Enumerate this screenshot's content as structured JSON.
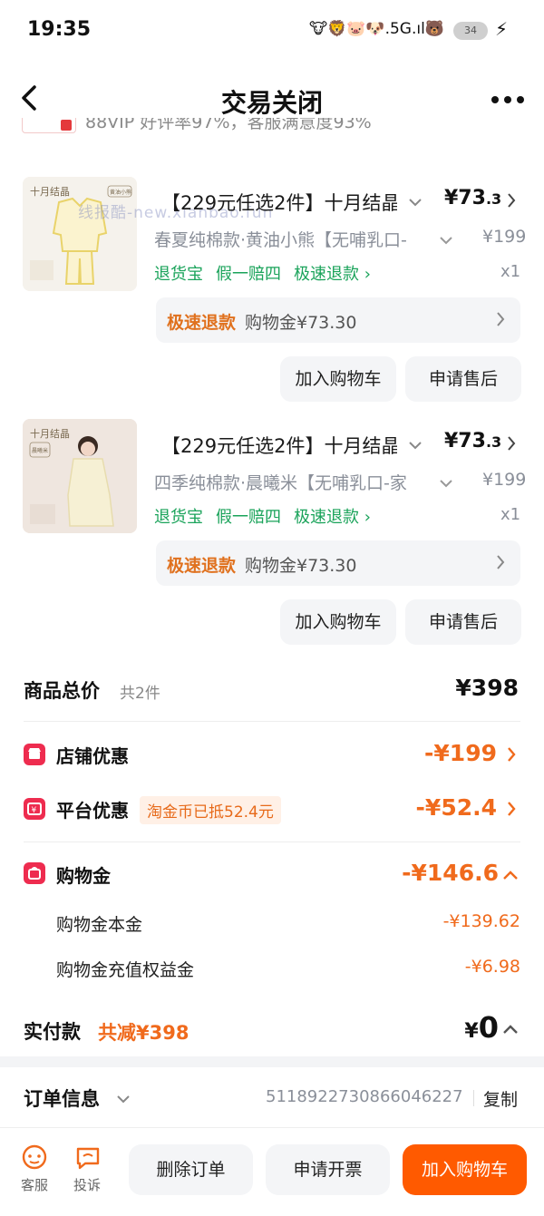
{
  "status_bar": {
    "time": "19:35",
    "icons": "🐮🦁🐷🐶.5G.ıl🐻",
    "battery": "34"
  },
  "header": {
    "title": "交易关闭"
  },
  "banner_peek": {
    "text": "88VIP 好评率97%，客服满意度93%"
  },
  "watermark": "线报酷-new.xianbao.fun",
  "products": [
    {
      "title": "【229元任选2件】十月结晶",
      "price_main": "¥73",
      "price_decimal": ".3",
      "sku": "春夏纯棉款·黄油小熊【无哺乳口-",
      "orig_price": "¥199",
      "tags": [
        "退货宝",
        "假一赔四",
        "极速退款 ›"
      ],
      "qty": "x1",
      "refund_label": "极速退款",
      "refund_text": "购物金¥73.30",
      "thumb_brand": "十月结晶",
      "thumb_label": "黄油小熊",
      "btn_cart": "加入购物车",
      "btn_after_sale": "申请售后"
    },
    {
      "title": "【229元任选2件】十月结晶",
      "price_main": "¥73",
      "price_decimal": ".3",
      "sku": "四季纯棉款·晨曦米【无哺乳口-家",
      "orig_price": "¥199",
      "tags": [
        "退货宝",
        "假一赔四",
        "极速退款 ›"
      ],
      "qty": "x1",
      "refund_label": "极速退款",
      "refund_text": "购物金¥73.30",
      "thumb_brand": "十月结晶",
      "thumb_label": "晨曦米",
      "btn_cart": "加入购物车",
      "btn_after_sale": "申请售后"
    }
  ],
  "summary": {
    "total_label": "商品总价",
    "total_count": "共2件",
    "total_amount": "¥398",
    "shop_discount_label": "店铺优惠",
    "shop_discount_amount": "-¥199",
    "platform_discount_label": "平台优惠",
    "platform_coin_tag": "淘金币已抵52.4元",
    "platform_discount_amount": "-¥52.4",
    "shopping_gold_label": "购物金",
    "shopping_gold_amount": "-¥146.6",
    "gold_principal_label": "购物金本金",
    "gold_principal_amount": "-¥139.62",
    "gold_bonus_label": "购物金充值权益金",
    "gold_bonus_amount": "-¥6.98",
    "paid_label": "实付款",
    "paid_saved": "共减¥398",
    "paid_amount_symbol": "¥",
    "paid_amount": "0"
  },
  "order_info": {
    "label": "订单信息",
    "order_no": "5118922730866046227",
    "copy": "复制"
  },
  "bottom": {
    "service_label": "客服",
    "complain_label": "投诉",
    "delete_btn": "删除订单",
    "invoice_btn": "申请开票",
    "cart_btn": "加入购物车"
  },
  "colors": {
    "accent": "#f06a1c",
    "green": "#1aa35a",
    "red_icon": "#ee2c4f",
    "cta": "#ff5a00"
  }
}
